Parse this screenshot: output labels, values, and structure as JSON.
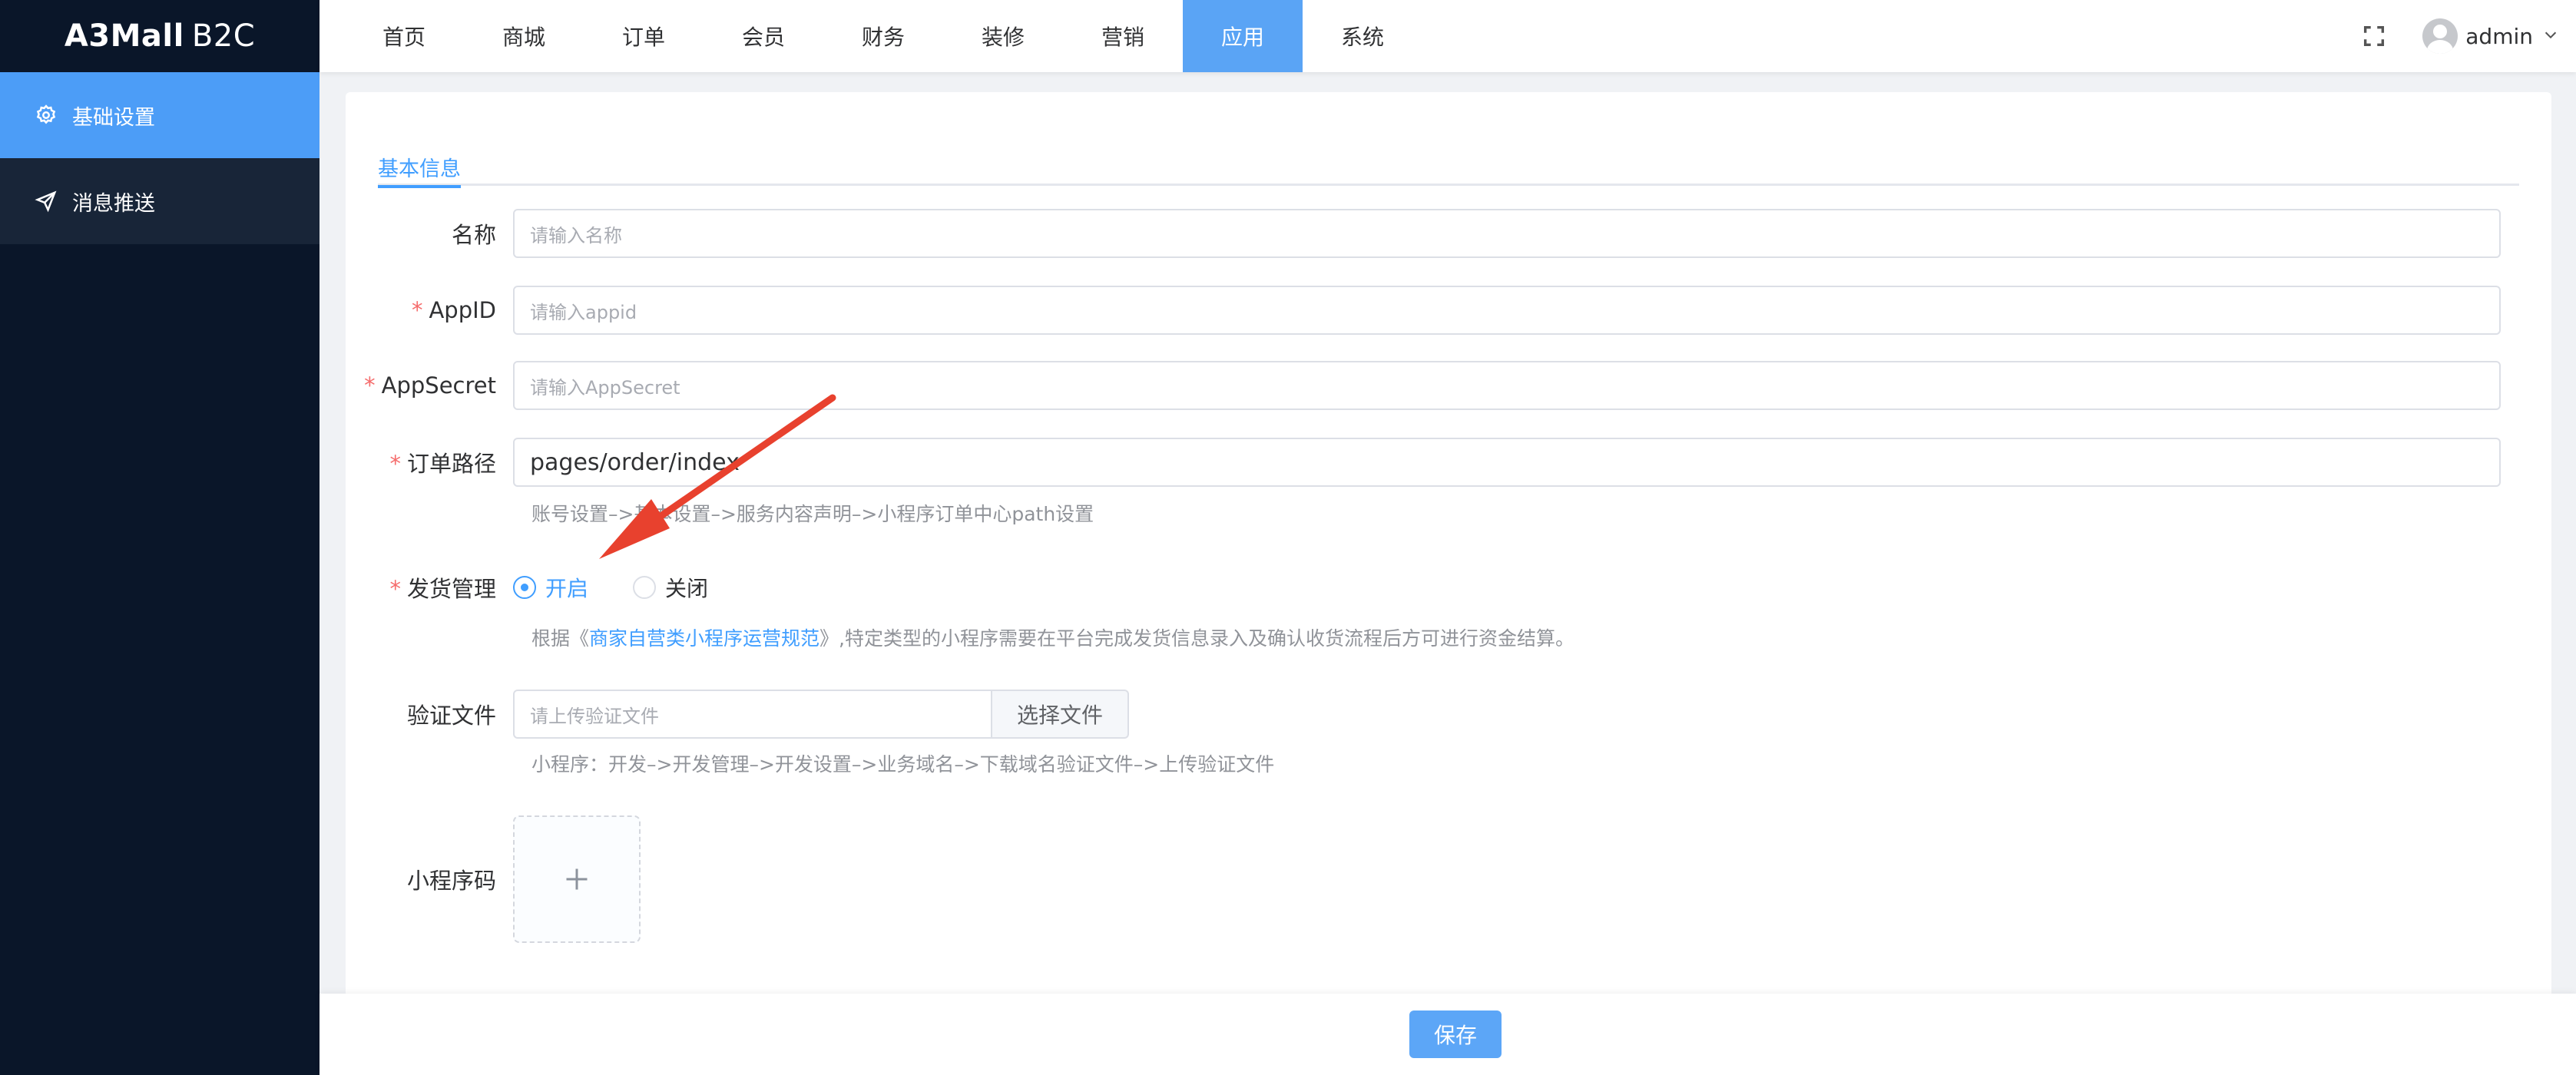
{
  "sidebar": {
    "logo_bold": "A3Mall",
    "logo_rest": "B2C",
    "items": [
      {
        "label": "基础设置",
        "icon": "gear-icon"
      },
      {
        "label": "消息推送",
        "icon": "send-icon"
      }
    ]
  },
  "topnav": {
    "items": [
      "首页",
      "商城",
      "订单",
      "会员",
      "财务",
      "装修",
      "营销",
      "应用",
      "系统"
    ],
    "active": "应用",
    "user": "admin"
  },
  "tabs": {
    "active": "基本信息"
  },
  "form": {
    "name": {
      "label": "名称",
      "placeholder": "请输入名称",
      "required": false
    },
    "appid": {
      "label": "AppID",
      "placeholder": "请输入appid",
      "required": true
    },
    "appsecret": {
      "label": "AppSecret",
      "placeholder": "请输入AppSecret",
      "required": true
    },
    "order_path": {
      "label": "订单路径",
      "value": "pages/order/index",
      "required": true,
      "help": "账号设置–>基本设置–>服务内容声明–>小程序订单中心path设置"
    },
    "shipping": {
      "label": "发货管理",
      "required": true,
      "options": [
        "开启",
        "关闭"
      ],
      "selected": "开启",
      "help_prefix": "根据《",
      "help_link": "商家自营类小程序运营规范",
      "help_suffix": "》,特定类型的小程序需要在平台完成发货信息录入及确认收货流程后方可进行资金结算。"
    },
    "verify_file": {
      "label": "验证文件",
      "placeholder": "请上传验证文件",
      "button": "选择文件",
      "help": "小程序：开发–>开发管理–>开发设置–>业务域名–>下载域名验证文件–>上传验证文件"
    },
    "qrcode": {
      "label": "小程序码"
    }
  },
  "footer": {
    "save_label": "保存"
  },
  "colors": {
    "primary": "#409eff",
    "sidebar": "#0a1629",
    "sidebar_active": "#4c9df7",
    "nav_active": "#5aa4f5",
    "required": "#f56c6c",
    "arrow": "#e8412e"
  }
}
